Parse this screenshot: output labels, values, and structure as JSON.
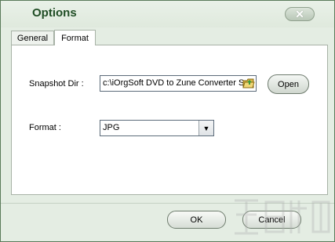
{
  "window": {
    "title": "Options",
    "close_icon": "close-x"
  },
  "tabs": [
    {
      "label": "General"
    },
    {
      "label": "Format"
    }
  ],
  "active_tab": "Format",
  "snapshot": {
    "label": "Snapshot Dir :",
    "path": "c:\\iOrgSoft DVD to Zune Converter Sn",
    "browse_icon": "folder-icon",
    "open_label": "Open"
  },
  "format": {
    "label": "Format :",
    "selected": "JPG",
    "arrow_icon": "chevron-down-icon"
  },
  "footer": {
    "ok_label": "OK",
    "cancel_label": "Cancel"
  },
  "colors": {
    "title_text": "#1f4d24",
    "window_bg": "#e4ede3",
    "panel_bg": "#ffffff"
  }
}
